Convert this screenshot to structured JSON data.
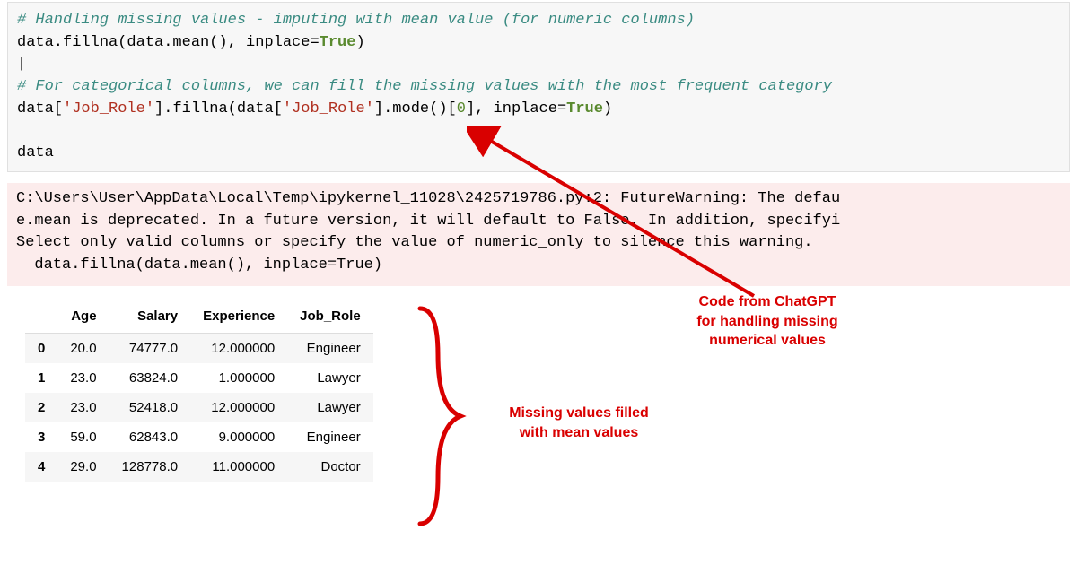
{
  "code": {
    "comment1": "# Handling missing values - imputing with mean value (for numeric columns)",
    "line1a": "data.fillna(data.mean(), inplace=",
    "line1b": ")",
    "true": "True",
    "cursor": "|",
    "comment2": "# For categorical columns, we can fill the missing values with the most frequent category",
    "line2a": "data[",
    "str1": "'Job_Role'",
    "line2b": "].fillna(data[",
    "str2": "'Job_Role'",
    "line2c": "].mode()[",
    "zero": "0",
    "line2d": "], inplace=",
    "line2e": ")",
    "line3": "data"
  },
  "warn": {
    "l1": "C:\\Users\\User\\AppData\\Local\\Temp\\ipykernel_11028\\2425719786.py:2: FutureWarning: The defau",
    "l2": "e.mean is deprecated. In a future version, it will default to False. In addition, specifyi",
    "l3": "Select only valid columns or specify the value of numeric_only to silence this warning.",
    "l4": "  data.fillna(data.mean(), inplace=True)"
  },
  "table": {
    "headers": [
      "Age",
      "Salary",
      "Experience",
      "Job_Role"
    ],
    "rows": [
      {
        "idx": "0",
        "age": "20.0",
        "salary": "74777.0",
        "exp": "12.000000",
        "role": "Engineer"
      },
      {
        "idx": "1",
        "age": "23.0",
        "salary": "63824.0",
        "exp": "1.000000",
        "role": "Lawyer"
      },
      {
        "idx": "2",
        "age": "23.0",
        "salary": "52418.0",
        "exp": "12.000000",
        "role": "Lawyer"
      },
      {
        "idx": "3",
        "age": "59.0",
        "salary": "62843.0",
        "exp": "9.000000",
        "role": "Engineer"
      },
      {
        "idx": "4",
        "age": "29.0",
        "salary": "128778.0",
        "exp": "11.000000",
        "role": "Doctor"
      }
    ]
  },
  "annotations": {
    "a1": "Code from ChatGPT\nfor handling missing\nnumerical values",
    "a2": "Missing values filled\nwith mean values"
  },
  "colors": {
    "annot_red": "#d90000",
    "warn_bg": "#fcecec",
    "code_bg": "#f7f7f7"
  }
}
